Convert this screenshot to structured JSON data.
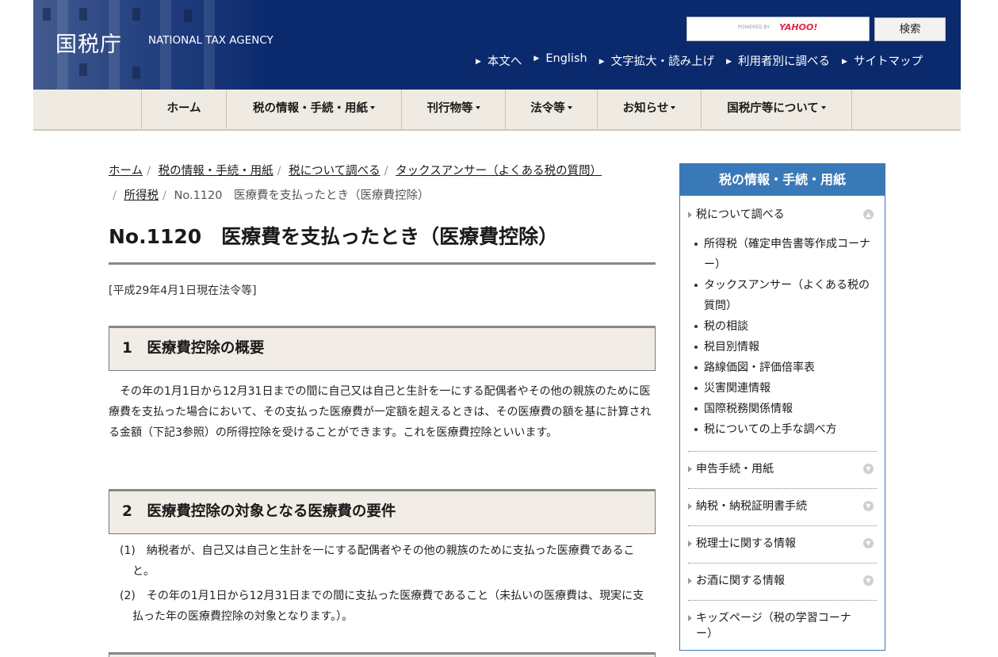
{
  "header": {
    "logo_jp": "国税庁",
    "logo_en": "NATIONAL TAX AGENCY",
    "search_powered": "POWERED BY",
    "search_yahoo": "YAHOO!",
    "search_button": "検索",
    "util_links": [
      "本文へ",
      "English",
      "文字拡大・読み上げ",
      "利用者別に調べる",
      "サイトマップ"
    ]
  },
  "nav": {
    "items": [
      "ホーム",
      "税の情報・手続・用紙",
      "刊行物等",
      "法令等",
      "お知らせ",
      "国税庁等について"
    ]
  },
  "breadcrumb": {
    "links": [
      "ホーム",
      "税の情報・手続・用紙",
      "税について調べる",
      "タックスアンサー（よくある税の質問）",
      "所得税"
    ],
    "current": "No.1120　医療費を支払ったとき（医療費控除）"
  },
  "main": {
    "title": "No.1120　医療費を支払ったとき（医療費控除）",
    "law_date": "[平成29年4月1日現在法令等]",
    "sections": [
      {
        "heading": "1　医療費控除の概要",
        "body": "その年の1月1日から12月31日までの間に自己又は自己と生計を一にする配偶者やその他の親族のために医療費を支払った場合において、その支払った医療費が一定額を超えるときは、その医療費の額を基に計算される金額（下記3参照）の所得控除を受けることができます。これを医療費控除といいます。"
      },
      {
        "heading": "2　医療費控除の対象となる医療費の要件",
        "items": [
          "(1)　納税者が、自己又は自己と生計を一にする配偶者やその他の親族のために支払った医療費であること。",
          "(2)　その年の1月1日から12月31日までの間に支払った医療費であること（未払いの医療費は、現実に支払った年の医療費控除の対象となります。）。"
        ]
      }
    ]
  },
  "sidebar": {
    "title": "税の情報・手続・用紙",
    "open_category": "税について調べる",
    "sub_items": [
      "所得税（確定申告書等作成コーナー）",
      "タックスアンサー（よくある税の質問）",
      "税の相談",
      "税目別情報",
      "路線価図・評価倍率表",
      "災害関連情報",
      "国際税務関係情報",
      "税についての上手な調べ方"
    ],
    "categories": [
      "申告手続・用紙",
      "納税・納税証明書手続",
      "税理士に関する情報",
      "お酒に関する情報",
      "キッズページ（税の学習コーナー）"
    ]
  },
  "colors": {
    "header_bg": "#0b2a6e",
    "nav_bg": "#f0ebe2",
    "sidebar_accent": "#3a79b8",
    "section_bg": "#f1ede6"
  }
}
